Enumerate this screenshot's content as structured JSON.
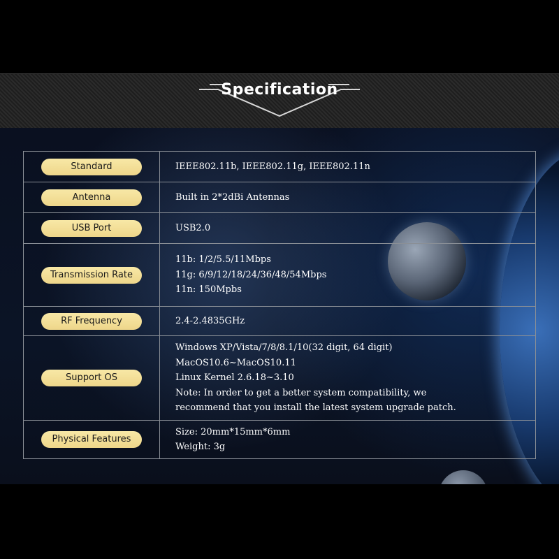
{
  "header": {
    "title": "Specification"
  },
  "rows": [
    {
      "label": "Standard",
      "values": [
        "IEEE802.11b, IEEE802.11g, IEEE802.11n"
      ]
    },
    {
      "label": "Antenna",
      "values": [
        "Built in 2*2dBi Antennas"
      ]
    },
    {
      "label": "USB Port",
      "values": [
        "USB2.0"
      ]
    },
    {
      "label": "Transmission Rate",
      "values": [
        "11b: 1/2/5.5/11Mbps",
        "11g: 6/9/12/18/24/36/48/54Mbps",
        "11n: 150Mpbs"
      ]
    },
    {
      "label": "RF Frequency",
      "values": [
        "2.4-2.4835GHz"
      ]
    },
    {
      "label": "Support OS",
      "values": [
        "Windows XP/Vista/7/8/8.1/10(32 digit, 64 digit)",
        "MacOS10.6~MacOS10.11",
        "Linux Kernel 2.6.18~3.10",
        "Note: In order to get a better system compatibility, we",
        "recommend that you install the latest system upgrade patch."
      ]
    },
    {
      "label": "Physical Features",
      "values": [
        "Size: 20mm*15mm*6mm",
        "Weight: 3g"
      ]
    }
  ],
  "colors": {
    "pill": "#f3dd93",
    "border": "#8a8f96",
    "background": "#000000"
  }
}
